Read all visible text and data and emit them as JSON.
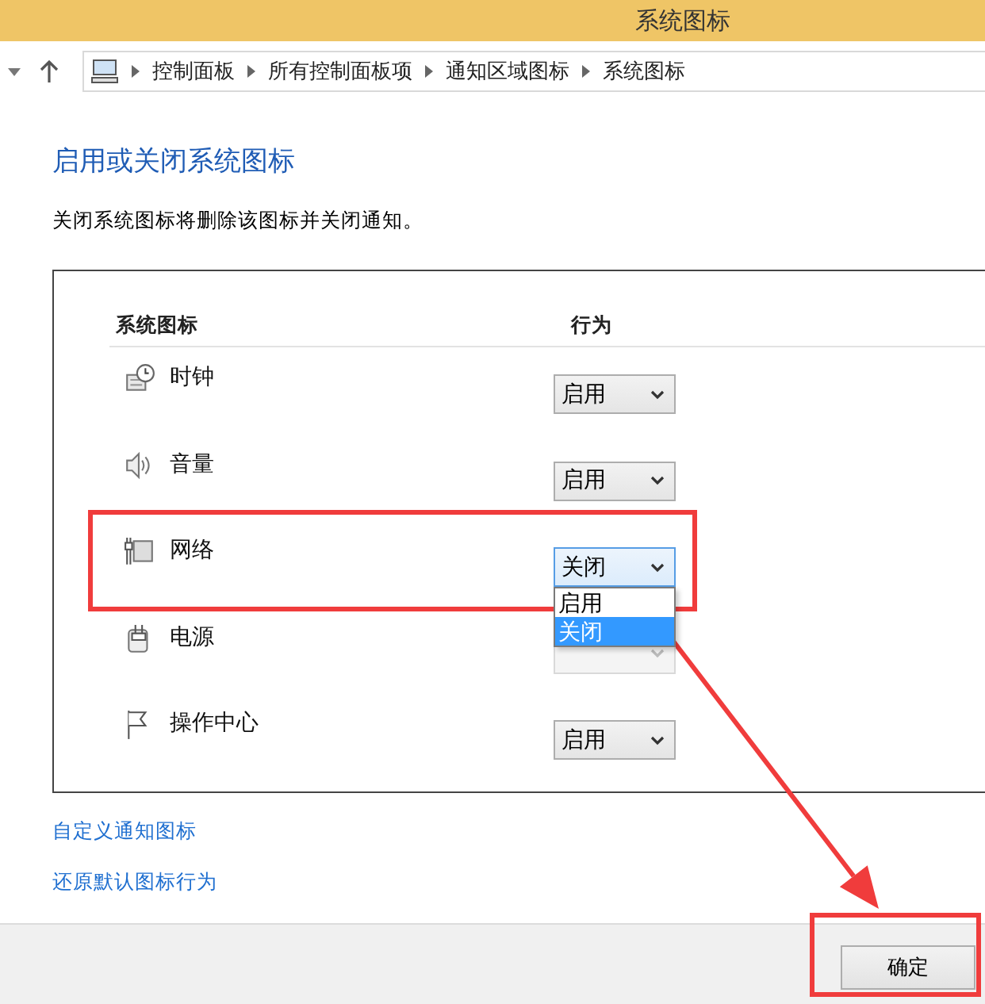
{
  "window": {
    "title": "系统图标"
  },
  "address_bar": {
    "crumbs": [
      "控制面板",
      "所有控制面板项",
      "通知区域图标",
      "系统图标"
    ]
  },
  "heading": "启用或关闭系统图标",
  "description": "关闭系统图标将删除该图标并关闭通知。",
  "table": {
    "columns": [
      "系统图标",
      "行为"
    ],
    "rows": [
      {
        "kind": "clock",
        "name": "时钟",
        "behavior": "启用",
        "disabled": false,
        "expanded": false
      },
      {
        "kind": "speaker",
        "name": "音量",
        "behavior": "启用",
        "disabled": false,
        "expanded": false
      },
      {
        "kind": "network",
        "name": "网络",
        "behavior": "关闭",
        "disabled": false,
        "expanded": true,
        "options": [
          {
            "label": "启用",
            "selected": false
          },
          {
            "label": "关闭",
            "selected": true
          }
        ]
      },
      {
        "kind": "plug",
        "name": "电源",
        "disabled": true,
        "expanded": false
      },
      {
        "kind": "flag",
        "name": "操作中心",
        "behavior": "启用",
        "disabled": false,
        "expanded": false
      }
    ]
  },
  "links": [
    "自定义通知图标",
    "还原默认图标行为"
  ],
  "buttons": [
    "确定"
  ],
  "annotations": [
    {
      "kind": "box"
    },
    {
      "kind": "box"
    },
    {
      "kind": "arrow"
    }
  ]
}
